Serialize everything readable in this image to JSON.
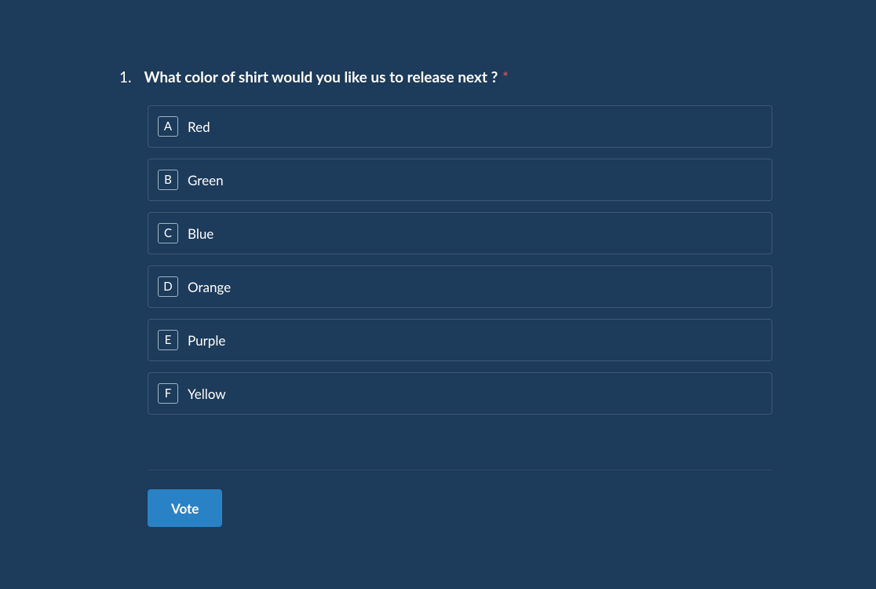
{
  "question": {
    "number": "1.",
    "text": "What color of shirt would you like us to release next ?",
    "required_mark": "*",
    "options": [
      {
        "key": "A",
        "label": "Red"
      },
      {
        "key": "B",
        "label": "Green"
      },
      {
        "key": "C",
        "label": "Blue"
      },
      {
        "key": "D",
        "label": "Orange"
      },
      {
        "key": "E",
        "label": "Purple"
      },
      {
        "key": "F",
        "label": "Yellow"
      }
    ]
  },
  "actions": {
    "vote_label": "Vote"
  },
  "colors": {
    "background": "#1d3b5a",
    "option_border": "#3d5a77",
    "button": "#2a82c6",
    "required": "#e14b4b"
  }
}
